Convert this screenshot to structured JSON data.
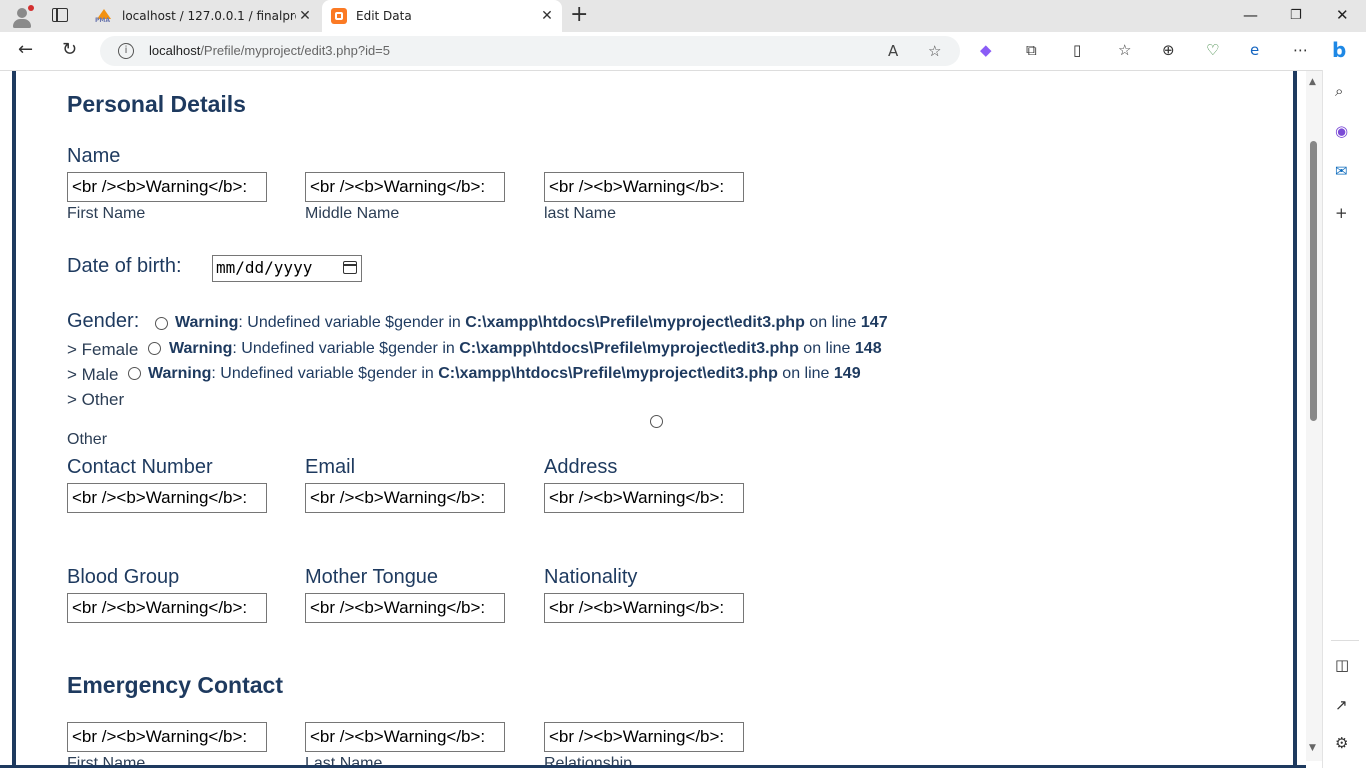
{
  "browser": {
    "tabs": [
      {
        "title": "localhost / 127.0.0.1 / finalproject",
        "favicon": "phpmyadmin-icon",
        "active": false
      },
      {
        "title": "Edit Data",
        "favicon": "xampp-icon",
        "active": true
      }
    ],
    "url_host": "localhost",
    "url_path": "/Prefile/myproject/edit3.php?id=5"
  },
  "page": {
    "personal_heading": "Personal Details",
    "name_label": "Name",
    "first_name_label": "First Name",
    "middle_name_label": "Middle Name",
    "last_name_label": "last Name",
    "input_value": "<br /><b>Warning</b>:",
    "dob_label": "Date of birth:",
    "dob_placeholder": "mm/dd/yyyy",
    "gender_label": "Gender:",
    "warning_word": "Warning",
    "warning_text": ": Undefined variable $gender in ",
    "warning_path": "C:\\xampp\\htdocs\\Prefile\\myproject\\edit3.php",
    "on_line": " on line ",
    "line_147": "147",
    "line_148": "148",
    "line_149": "149",
    "opt_female": "> Female",
    "opt_male": "> Male",
    "opt_other": "> Other",
    "other_label": "Other",
    "contact_label": "Contact Number",
    "email_label": "Email",
    "address_label": "Address",
    "blood_label": "Blood Group",
    "tongue_label": "Mother Tongue",
    "nationality_label": "Nationality",
    "emergency_heading": "Emergency Contact",
    "em_first_label": "First Name",
    "em_last_label": "Last Name",
    "em_relation_label": "Relationship"
  }
}
